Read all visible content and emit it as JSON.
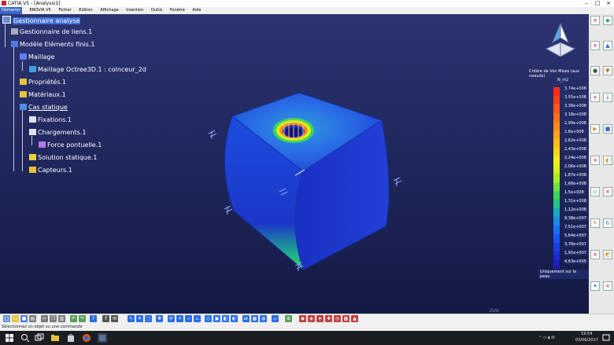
{
  "window": {
    "title": "CATIA V5 - [Analysis1]"
  },
  "menu": {
    "items": [
      "Démarrer",
      "ENOVIA V5",
      "Fichier",
      "Edition",
      "Affichage",
      "Insertion",
      "Outils",
      "Fenêtre",
      "Aide"
    ]
  },
  "tree": [
    {
      "label": "Gestionnaire analyse",
      "icon": "analysis-manager-icon"
    },
    {
      "label": "Gestionnaire de liens.1",
      "icon": "links-manager-icon"
    },
    {
      "label": "Modèle Eléments finis.1",
      "icon": "fem-model-icon"
    },
    {
      "label": "Maillage",
      "icon": "mesh-icon"
    },
    {
      "label": "Maillage Octree3D.1 : coinceur_2d",
      "icon": "octree-mesh-icon"
    },
    {
      "label": "Propriétés.1",
      "icon": "folder-icon"
    },
    {
      "label": "Matériaux.1",
      "icon": "folder-icon"
    },
    {
      "label": "Cas statique",
      "icon": "static-case-icon"
    },
    {
      "label": "Fixations.1",
      "icon": "restraint-icon"
    },
    {
      "label": "Chargements.1",
      "icon": "loads-icon"
    },
    {
      "label": "Force pontuelle.1",
      "icon": "point-force-icon"
    },
    {
      "label": "Solution statique.1",
      "icon": "static-solution-icon"
    },
    {
      "label": "Capteurs.1",
      "icon": "sensors-icon"
    }
  ],
  "legend": {
    "title": "Critère de Von Mises (aux noeuds)",
    "unit": "N_m2",
    "values": [
      "3,74e+008",
      "3,55e+008",
      "3,36e+008",
      "3,18e+008",
      "2,99e+008",
      "2,8e+008",
      "2,62e+008",
      "2,43e+008",
      "2,24e+008",
      "2,06e+008",
      "1,87e+008",
      "1,68e+008",
      "1,5e+008",
      "1,31e+008",
      "1,12e+008",
      "9,38e+007",
      "7,51e+007",
      "5,64e+007",
      "3,78e+007",
      "1,91e+007",
      "4,63e+005"
    ],
    "colors": [
      "#ff2a1a",
      "#ff3f1a",
      "#ff561a",
      "#ff701a",
      "#ff8a1a",
      "#ffa31a",
      "#ffbd1a",
      "#ffd61a",
      "#f4ec1a",
      "#d5f21a",
      "#a8ee22",
      "#70e43a",
      "#3fd45a",
      "#22c48a",
      "#1aa8bd",
      "#1a8ae0",
      "#1a6ef2",
      "#1a55f2",
      "#1a3ee6",
      "#1a2ad0",
      "#1a1fb5"
    ],
    "footer": "Uniquement sur la peau"
  },
  "status_bar": {
    "text": "Sélectionnez un objet ou une commande"
  },
  "taskbar": {
    "time": "19:54",
    "date": "03/06/2017"
  },
  "viewport_watermark": "ZUSI"
}
